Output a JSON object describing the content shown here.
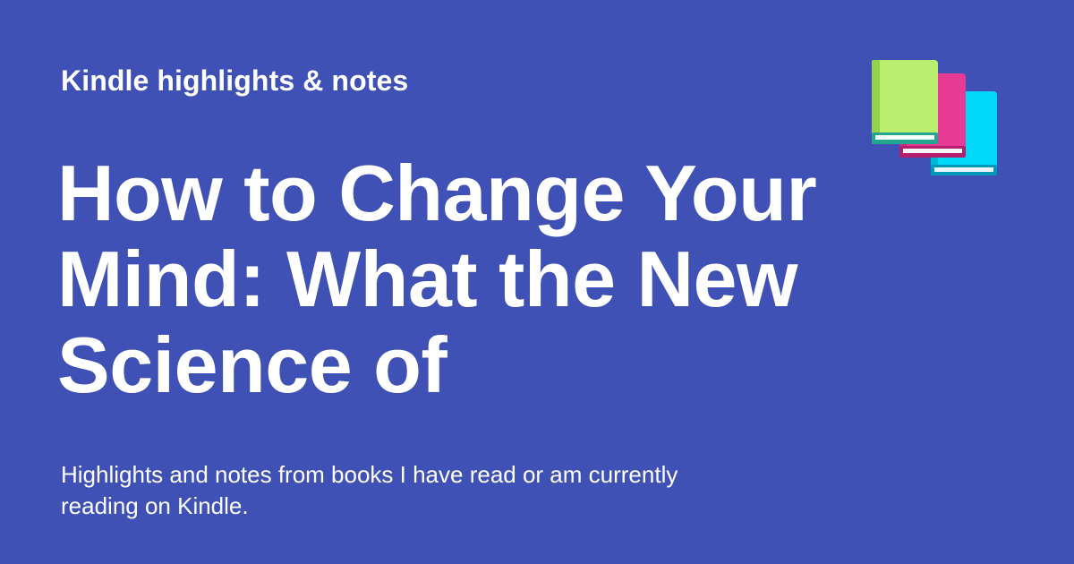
{
  "site_label": "Kindle highlights & notes",
  "book_title": "How to Change Your Mind: What the New Science of",
  "description": "Highlights and notes from books I have read or am currently reading on Kindle.",
  "icons": {
    "books": "stacked-books-icon"
  },
  "colors": {
    "background": "#3f51b5",
    "text": "#ffffff",
    "book_green": "#b9ee6f",
    "book_pink": "#e63b94",
    "book_blue": "#00d8f8"
  }
}
